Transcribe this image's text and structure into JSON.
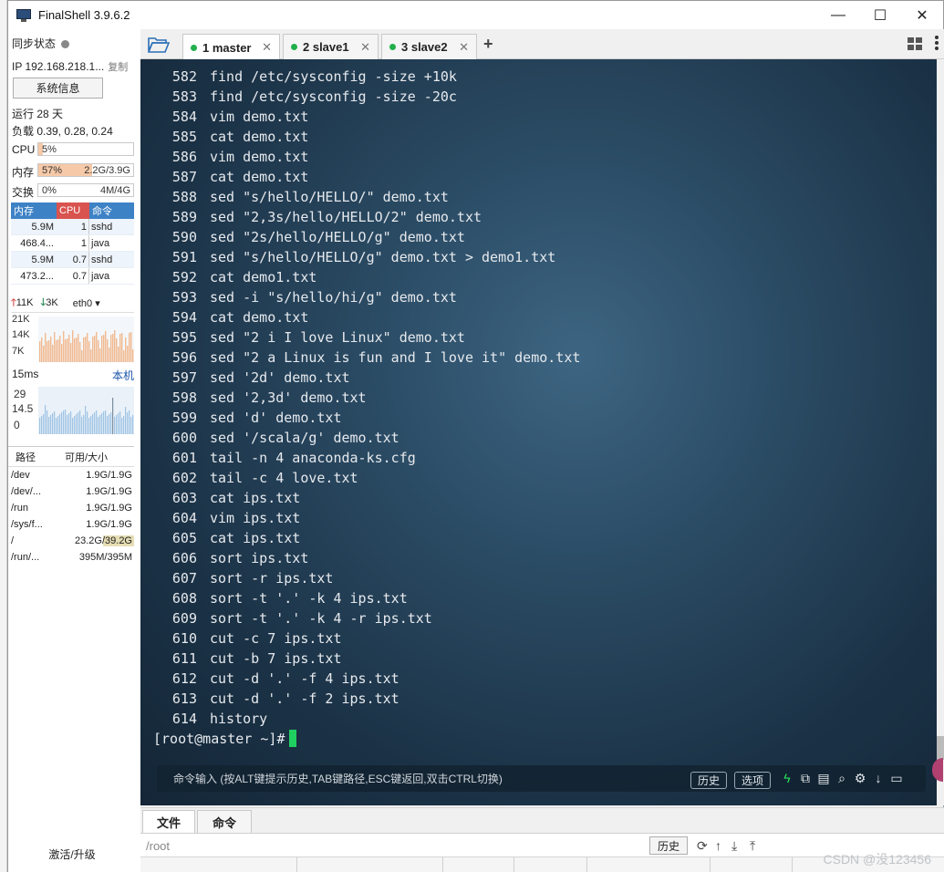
{
  "window": {
    "title": "FinalShell 3.9.6.2",
    "minimize": "—",
    "maximize": "☐",
    "close": "✕"
  },
  "sidebar": {
    "sync_label": "同步状态",
    "ip": "IP 192.168.218.1...",
    "copy": "复制",
    "sysinfo_button": "系统信息",
    "uptime": "运行 28 天",
    "load": "负载 0.39, 0.28, 0.24",
    "cpu": {
      "label": "CPU",
      "value": "5%",
      "fill": 0.05
    },
    "mem": {
      "label": "内存",
      "value": "57%",
      "detail": "2.2G/3.9G",
      "fill": 0.57
    },
    "swap": {
      "label": "交换",
      "value": "0%",
      "detail": "4M/4G",
      "fill": 0.0
    },
    "process_headers": [
      "内存",
      "CPU",
      "命令"
    ],
    "processes": [
      {
        "mem": "5.9M",
        "cpu": "1",
        "cmd": "sshd"
      },
      {
        "mem": "468.4...",
        "cpu": "1",
        "cmd": "java"
      },
      {
        "mem": "5.9M",
        "cpu": "0.7",
        "cmd": "sshd"
      },
      {
        "mem": "473.2...",
        "cpu": "0.7",
        "cmd": "java"
      }
    ],
    "net": {
      "up": "11K",
      "down": "3K",
      "iface": "eth0",
      "ticks": [
        "21K",
        "14K",
        "7K"
      ]
    },
    "latency": {
      "ms": "15ms",
      "host": "本机",
      "ticks": [
        "29",
        "14.5",
        "0"
      ]
    },
    "disk_headers": [
      "路径",
      "可用/大小"
    ],
    "disks": [
      {
        "path": "/dev",
        "size": "1.9G/1.9G"
      },
      {
        "path": "/dev/...",
        "size": "1.9G/1.9G"
      },
      {
        "path": "/run",
        "size": "1.9G/1.9G"
      },
      {
        "path": "/sys/f...",
        "size": "1.9G/1.9G"
      },
      {
        "path": "/",
        "size": "23.2G/39.2G"
      },
      {
        "path": "/run/...",
        "size": "395M/395M"
      }
    ],
    "activate": "激活/升级"
  },
  "tabs": [
    {
      "label": "1 master",
      "active": true
    },
    {
      "label": "2 slave1",
      "active": false
    },
    {
      "label": "3 slave2",
      "active": false
    }
  ],
  "tab_close": "✕",
  "tab_add": "+",
  "terminal": {
    "lines": [
      {
        "num": "582",
        "cmd": "find /etc/sysconfig -size +10k"
      },
      {
        "num": "583",
        "cmd": "find /etc/sysconfig -size -20c"
      },
      {
        "num": "584",
        "cmd": "vim demo.txt"
      },
      {
        "num": "585",
        "cmd": "cat demo.txt"
      },
      {
        "num": "586",
        "cmd": "vim demo.txt"
      },
      {
        "num": "587",
        "cmd": "cat demo.txt"
      },
      {
        "num": "588",
        "cmd": "sed \"s/hello/HELLO/\" demo.txt"
      },
      {
        "num": "589",
        "cmd": "sed \"2,3s/hello/HELLO/2\" demo.txt"
      },
      {
        "num": "590",
        "cmd": "sed \"2s/hello/HELLO/g\" demo.txt"
      },
      {
        "num": "591",
        "cmd": "sed \"s/hello/HELLO/g\" demo.txt > demo1.txt"
      },
      {
        "num": "592",
        "cmd": "cat demo1.txt"
      },
      {
        "num": "593",
        "cmd": "sed -i \"s/hello/hi/g\" demo.txt"
      },
      {
        "num": "594",
        "cmd": "cat demo.txt"
      },
      {
        "num": "595",
        "cmd": "sed \"2 i I love Linux\" demo.txt"
      },
      {
        "num": "596",
        "cmd": "sed \"2 a Linux is fun and I love it\" demo.txt"
      },
      {
        "num": "597",
        "cmd": "sed '2d' demo.txt"
      },
      {
        "num": "598",
        "cmd": "sed '2,3d' demo.txt"
      },
      {
        "num": "599",
        "cmd": "sed 'd' demo.txt"
      },
      {
        "num": "600",
        "cmd": "sed '/scala/g' demo.txt"
      },
      {
        "num": "601",
        "cmd": "tail -n 4 anaconda-ks.cfg"
      },
      {
        "num": "602",
        "cmd": "tail -c 4 love.txt"
      },
      {
        "num": "603",
        "cmd": "cat ips.txt"
      },
      {
        "num": "604",
        "cmd": "vim ips.txt"
      },
      {
        "num": "605",
        "cmd": "cat ips.txt"
      },
      {
        "num": "606",
        "cmd": "sort ips.txt"
      },
      {
        "num": "607",
        "cmd": "sort -r ips.txt"
      },
      {
        "num": "608",
        "cmd": "sort -t '.' -k 4 ips.txt"
      },
      {
        "num": "609",
        "cmd": "sort -t '.' -k 4 -r ips.txt"
      },
      {
        "num": "610",
        "cmd": "cut -c 7 ips.txt"
      },
      {
        "num": "611",
        "cmd": "cut -b 7 ips.txt"
      },
      {
        "num": "612",
        "cmd": "cut -d '.' -f 4 ips.txt"
      },
      {
        "num": "613",
        "cmd": "cut -d '.' -f 2 ips.txt"
      },
      {
        "num": "614",
        "cmd": "history"
      }
    ],
    "prompt": "[root@master ~]#"
  },
  "command_bar": {
    "placeholder": "命令输入 (按ALT键提示历史,TAB键路径,ESC键返回,双击CTRL切换)",
    "history_button": "历史",
    "options_button": "选项"
  },
  "bottom": {
    "tabs": [
      "文件",
      "命令"
    ],
    "path": "/root",
    "history_button": "历史"
  },
  "watermark": "CSDN @没123456",
  "colors": {
    "terminal_bg": "#2a4a63",
    "cursor": "#1fd060",
    "tab_dot": "#21b04b",
    "mem_header": "#3e82c6",
    "cpu_header": "#d9534f"
  }
}
